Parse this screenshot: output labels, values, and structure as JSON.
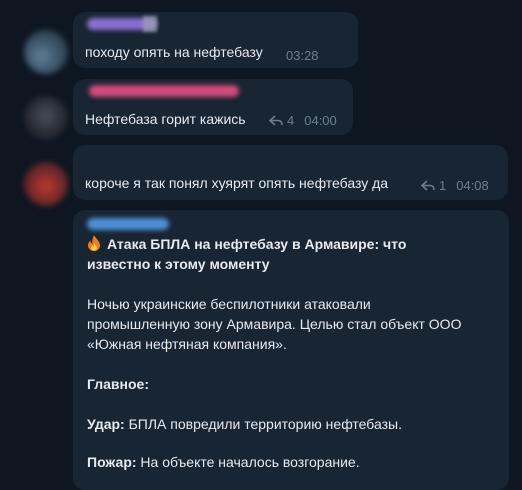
{
  "messages": [
    {
      "text": "походу опять на нефтебазу",
      "time": "03:28",
      "replies": ""
    },
    {
      "text": "Нефтебаза горит кажись",
      "time": "04:00",
      "replies": "4"
    },
    {
      "text": "короче я так понял хуярят опять нефтебазу да",
      "time": "04:08",
      "replies": "1"
    }
  ],
  "post": {
    "emoji": "🔥",
    "title": "Атака БПЛА на нефтебазу в Армавире: что известно к этому моменту",
    "intro": "Ночью украинские беспилотники атаковали промышленную зону Армавира. Целью стал объект ООО «Южная нефтяная компания».",
    "main_label": "Главное:",
    "strike_label": "Удар:",
    "strike_text": " БПЛА повредили территорию нефтебазы.",
    "fire_label": "Пожар:",
    "fire_text": " На объекте началось возгорание."
  },
  "colors": {
    "background": "#0e1621",
    "bubble": "#182533",
    "meta": "#6d7f8f",
    "text": "#e6ebf0"
  }
}
